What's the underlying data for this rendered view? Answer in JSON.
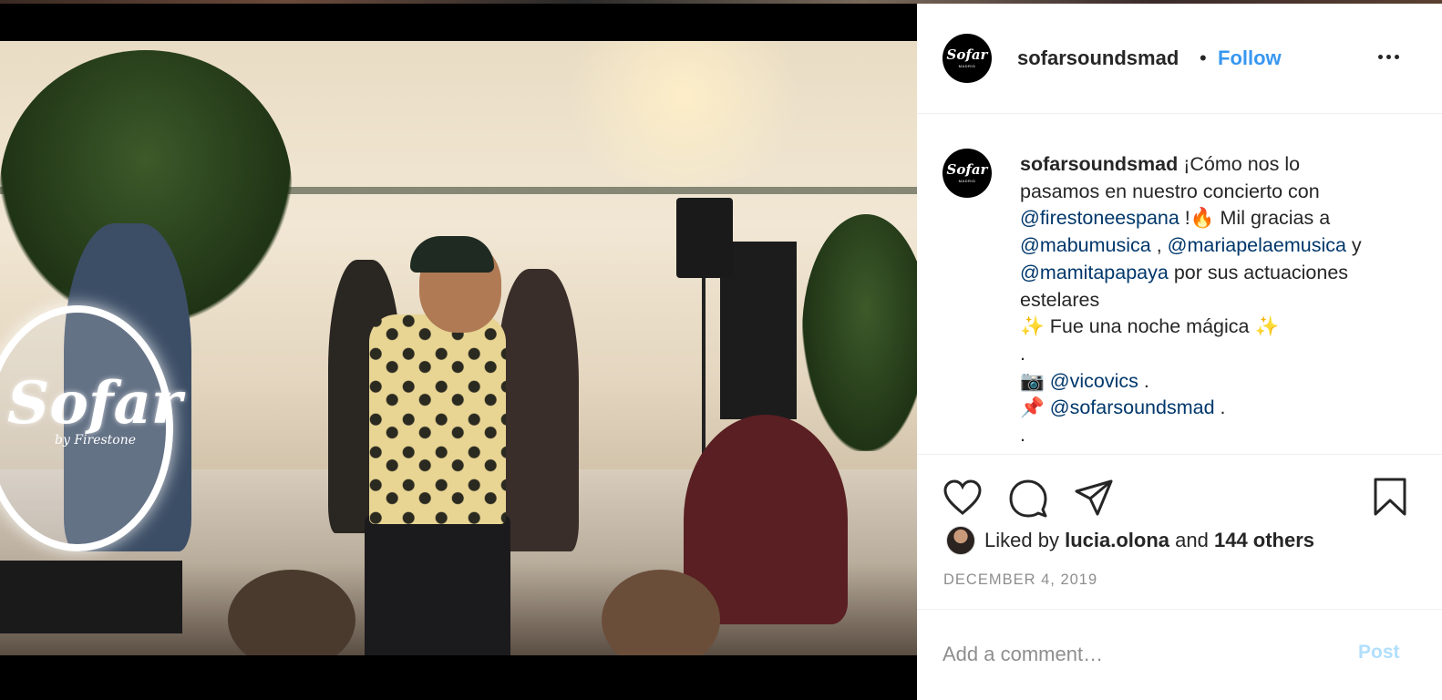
{
  "post": {
    "username": "sofarsoundsmad",
    "separator": "•",
    "follow_label": "Follow",
    "avatar_logo": "Sofar",
    "avatar_sub": "MADRID",
    "photo_sign": {
      "logo": "Sofar",
      "sub": "by Firestone"
    }
  },
  "caption": {
    "username": "sofarsoundsmad",
    "line1_text": "¡Cómo nos lo",
    "line2_text": "pasamos en nuestro concierto con",
    "mention_firestone": "@firestoneespana",
    "line3_suffix": " !🔥 Mil gracias a",
    "mention_mabu": "@mabumusica",
    "comma": " , ",
    "mention_mariapela": "@mariapelaemusica",
    "y": " y",
    "mention_mamita": "@mamitapapaya",
    "line5_suffix": " por sus actuaciones",
    "line6": "estelares",
    "line7": "✨ Fue una noche mágica ✨",
    "dot": ".",
    "camera": "📷",
    "mention_vicovics": "@vicovics",
    "pin": "📌",
    "mention_sofar": "@sofarsoundsmad",
    "dot_suffix": " ."
  },
  "likes": {
    "prefix": "Liked by",
    "user": "lucia.olona",
    "and": "and",
    "others": "144 others"
  },
  "date": "DECEMBER 4, 2019",
  "comment": {
    "placeholder": "Add a comment…",
    "post_label": "Post"
  },
  "colors": {
    "accent": "#3897f0",
    "mention": "#00376b",
    "muted": "#8e8e8e",
    "post_disabled": "#b2dffc"
  },
  "icons": [
    "heart-icon",
    "comment-icon",
    "share-icon",
    "bookmark-icon",
    "more-icon"
  ]
}
